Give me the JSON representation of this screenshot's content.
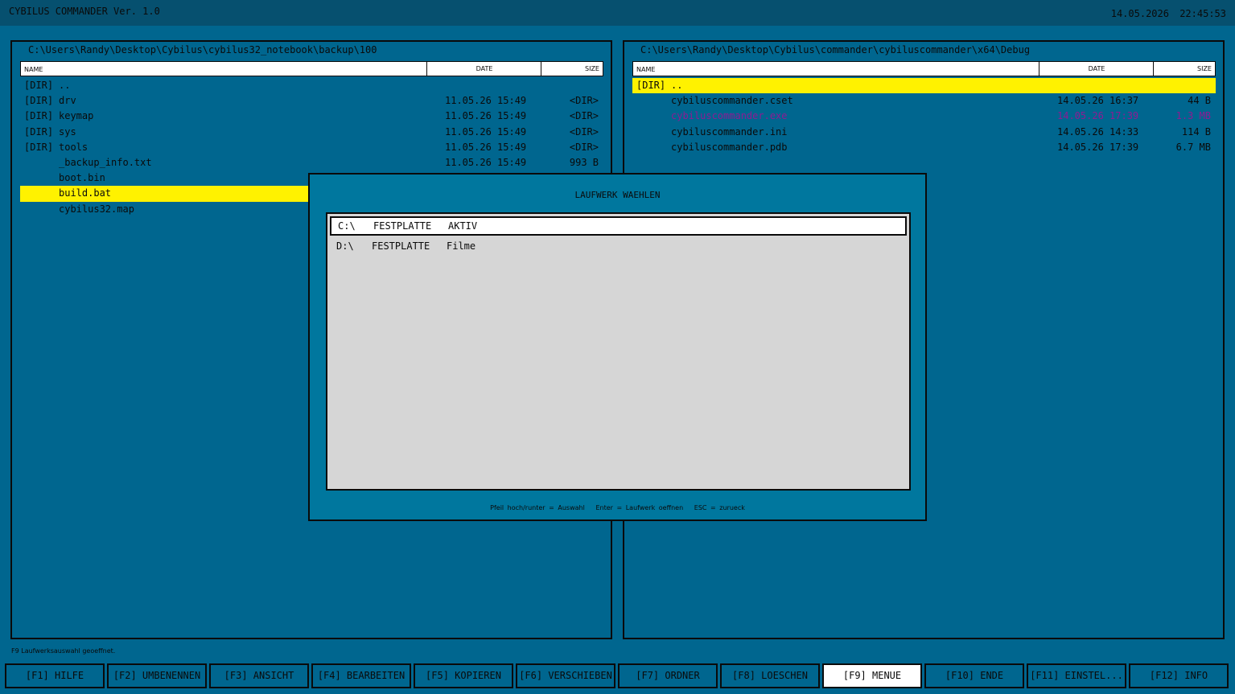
{
  "app": {
    "title": "CYBILUS COMMANDER Ver. 1.0",
    "date": "14.05.2026",
    "time": "22:45:53"
  },
  "columns": {
    "name": "NAME",
    "date": "DATE",
    "size": "SIZE"
  },
  "left_panel": {
    "path": "C:\\Users\\Randy\\Desktop\\Cybilus\\cybilus32_notebook\\backup\\100",
    "entries": [
      {
        "tag": "[DIR]",
        "name": "..",
        "date": "",
        "size": ""
      },
      {
        "tag": "[DIR]",
        "name": "drv",
        "date": "11.05.26 15:49",
        "size": "<DIR>"
      },
      {
        "tag": "[DIR]",
        "name": "keymap",
        "date": "11.05.26 15:49",
        "size": "<DIR>"
      },
      {
        "tag": "[DIR]",
        "name": "sys",
        "date": "11.05.26 15:49",
        "size": "<DIR>"
      },
      {
        "tag": "[DIR]",
        "name": "tools",
        "date": "11.05.26 15:49",
        "size": "<DIR>"
      },
      {
        "tag": "",
        "name": "_backup_info.txt",
        "date": "11.05.26 15:49",
        "size": "993 B"
      },
      {
        "tag": "",
        "name": "boot.bin",
        "date": "",
        "size": ""
      },
      {
        "tag": "",
        "name": "build.bat",
        "date": "",
        "size": ""
      },
      {
        "tag": "",
        "name": "cybilus32.map",
        "date": "",
        "size": ""
      }
    ]
  },
  "right_panel": {
    "path": "C:\\Users\\Randy\\Desktop\\Cybilus\\commander\\cybiluscommander\\x64\\Debug",
    "entries": [
      {
        "tag": "[DIR]",
        "name": "..",
        "date": "",
        "size": ""
      },
      {
        "tag": "",
        "name": "cybiluscommander.cset",
        "date": "14.05.26 16:37",
        "size": "44 B"
      },
      {
        "tag": "",
        "name": "cybiluscommander.exe",
        "date": "14.05.26 17:39",
        "size": "1.3 MB"
      },
      {
        "tag": "",
        "name": "cybiluscommander.ini",
        "date": "14.05.26 14:33",
        "size": "114 B"
      },
      {
        "tag": "",
        "name": "cybiluscommander.pdb",
        "date": "14.05.26 17:39",
        "size": "6.7 MB"
      }
    ]
  },
  "dialog": {
    "title": "LAUFWERK WAEHLEN",
    "drives": [
      {
        "letter": "C:\\",
        "type": "FESTPLATTE",
        "label": "AKTIV"
      },
      {
        "letter": "D:\\",
        "type": "FESTPLATTE",
        "label": "Filme"
      }
    ],
    "hint": "Pfeil hoch/runter = Auswahl   Enter = Laufwerk oeffnen   ESC = zurueck"
  },
  "status": "F9 Laufwerksauswahl geoeffnet.",
  "fkeys": [
    "[F1] HILFE",
    "[F2] UMBENENNEN",
    "[F3] ANSICHT",
    "[F4] BEARBEITEN",
    "[F5] KOPIEREN",
    "[F6] VERSCHIEBEN",
    "[F7] ORDNER",
    "[F8] LOESCHEN",
    "[F9] MENUE",
    "[F10] ENDE",
    "[F11] EINSTEL...",
    "[F12] INFO"
  ],
  "colors": {
    "background": "#00668f",
    "selection": "#fff200",
    "dialog": "#00779e",
    "executable": "#8e1b93"
  }
}
